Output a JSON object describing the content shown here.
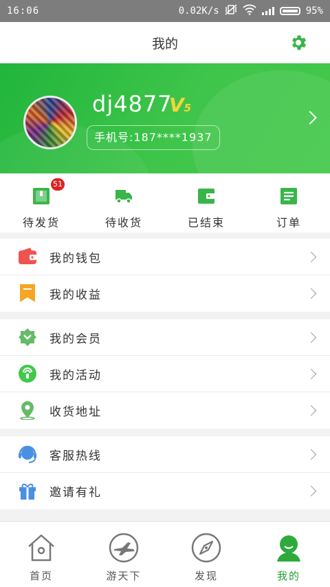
{
  "status_bar": {
    "time": "16:06",
    "network_speed": "0.02K/s",
    "battery": "95%"
  },
  "header": {
    "title": "我的"
  },
  "profile": {
    "username": "dj4877",
    "vip_letter": "V",
    "vip_level": "5",
    "phone": "手机号:187****1937"
  },
  "orders": [
    {
      "label": "待发货",
      "badge": "51",
      "icon": "pending-shipment-icon"
    },
    {
      "label": "待收货",
      "icon": "truck-icon"
    },
    {
      "label": "已结束",
      "icon": "wallet-closed-icon"
    },
    {
      "label": "订单",
      "icon": "order-list-icon"
    }
  ],
  "menu_groups": [
    [
      {
        "label": "我的钱包",
        "icon": "wallet-icon"
      },
      {
        "label": "我的收益",
        "icon": "bookmark-icon"
      }
    ],
    [
      {
        "label": "我的会员",
        "icon": "member-badge-icon"
      },
      {
        "label": "我的活动",
        "icon": "activity-icon"
      },
      {
        "label": "收货地址",
        "icon": "location-pin-icon"
      }
    ],
    [
      {
        "label": "客服热线",
        "icon": "headset-icon"
      },
      {
        "label": "邀请有礼",
        "icon": "gift-icon"
      }
    ]
  ],
  "tabbar": [
    {
      "label": "首页",
      "icon": "home-icon"
    },
    {
      "label": "游天下",
      "icon": "plane-icon"
    },
    {
      "label": "发现",
      "icon": "compass-icon"
    },
    {
      "label": "我的",
      "icon": "profile-icon",
      "active": true
    }
  ],
  "colors": {
    "brand_green": "#2dba3f",
    "accent_green": "#20a030",
    "badge_red": "#e02020",
    "vip_gold": "#f5d53a"
  }
}
